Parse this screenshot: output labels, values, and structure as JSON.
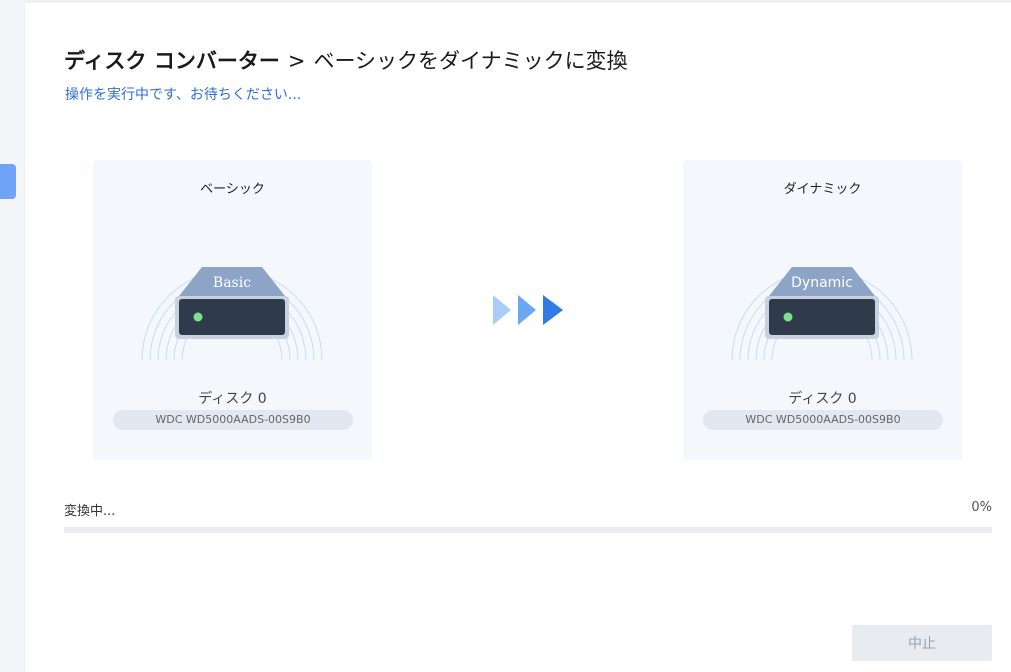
{
  "header": {
    "title": "ディスク コンバーター",
    "separator": ">",
    "subtitle": "ベーシックをダイナミックに変換",
    "status": "操作を実行中です、お待ちください..."
  },
  "source_disk": {
    "type_label": "ベーシック",
    "badge": "Basic",
    "disk_label": "ディスク 0",
    "model": "WDC WD5000AADS-00S9B0"
  },
  "target_disk": {
    "type_label": "ダイナミック",
    "badge": "Dynamic",
    "disk_label": "ディスク 0",
    "model": "WDC WD5000AADS-00S9B0"
  },
  "progress": {
    "label": "変換中...",
    "percent_text": "0%",
    "value": 0
  },
  "actions": {
    "stop_label": "中止"
  },
  "colors": {
    "accent": "#2f6fd6",
    "arrow_light": "#a9cdf7",
    "arrow_mid": "#6aa8f2",
    "arrow_dark": "#2f7ae8",
    "led": "#7ee08a"
  },
  "icons": [
    "disk-drive-icon",
    "triple-arrow-icon"
  ]
}
